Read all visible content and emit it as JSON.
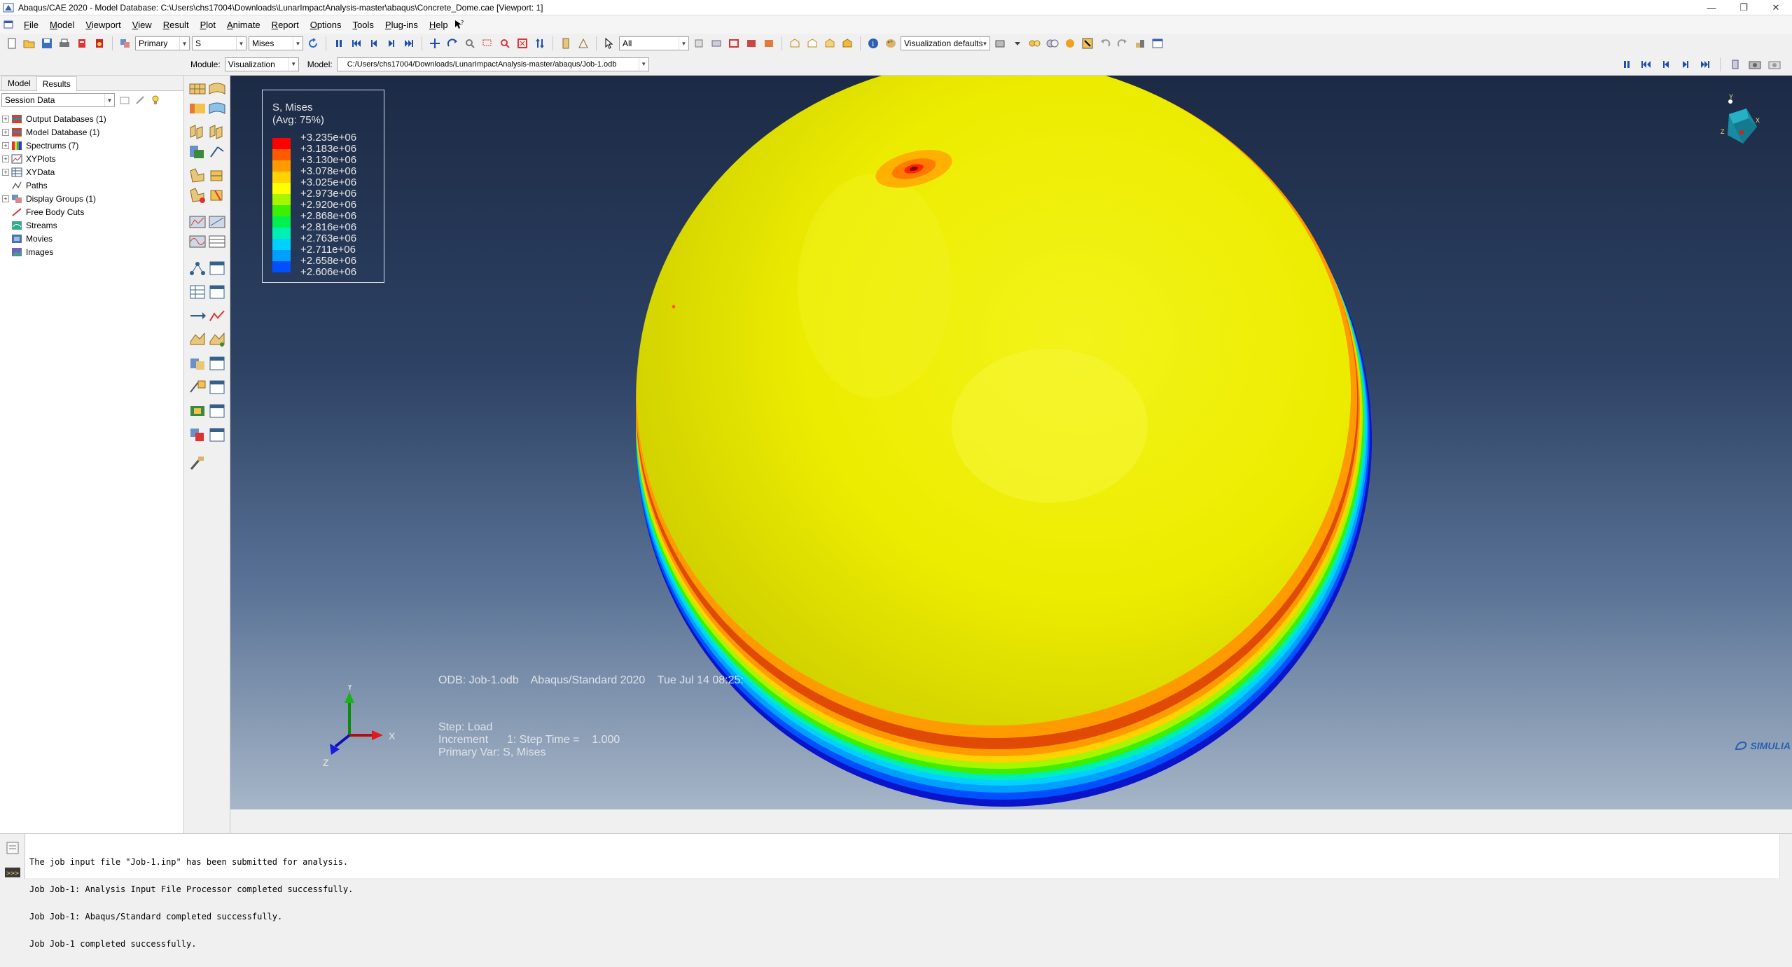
{
  "window": {
    "title": "Abaqus/CAE 2020 - Model Database: C:\\Users\\chs17004\\Downloads\\LunarImpactAnalysis-master\\abaqus\\Concrete_Dome.cae [Viewport: 1]",
    "min_glyph": "—",
    "max_glyph": "❐",
    "close_glyph": "✕"
  },
  "menu": [
    "File",
    "Model",
    "Viewport",
    "View",
    "Result",
    "Plot",
    "Animate",
    "Report",
    "Options",
    "Tools",
    "Plug-ins",
    "Help"
  ],
  "toolbar": {
    "display_group": "Primary",
    "variable": "S",
    "invariant": "Mises",
    "selection": "All",
    "view_defaults": "Visualization defaults",
    "module_label": "Module:",
    "module": "Visualization",
    "model_label": "Model:",
    "model_path": "C:/Users/chs17004/Downloads/LunarImpactAnalysis-master/abaqus/Job-1.odb"
  },
  "left_panel": {
    "tabs": [
      "Model",
      "Results"
    ],
    "active_tab": "Results",
    "session": "Session Data",
    "tree": [
      {
        "label": "Output Databases (1)",
        "expandable": true
      },
      {
        "label": "Model Database (1)",
        "expandable": true
      },
      {
        "label": "Spectrums (7)",
        "expandable": true
      },
      {
        "label": "XYPlots",
        "expandable": true
      },
      {
        "label": "XYData",
        "expandable": true
      },
      {
        "label": "Paths",
        "expandable": false
      },
      {
        "label": "Display Groups (1)",
        "expandable": true
      },
      {
        "label": "Free Body Cuts",
        "expandable": false
      },
      {
        "label": "Streams",
        "expandable": false
      },
      {
        "label": "Movies",
        "expandable": false
      },
      {
        "label": "Images",
        "expandable": false
      }
    ]
  },
  "legend": {
    "title": "S, Mises",
    "subtitle": "(Avg: 75%)",
    "values": [
      "+3.235e+06",
      "+3.183e+06",
      "+3.130e+06",
      "+3.078e+06",
      "+3.025e+06",
      "+2.973e+06",
      "+2.920e+06",
      "+2.868e+06",
      "+2.816e+06",
      "+2.763e+06",
      "+2.711e+06",
      "+2.658e+06",
      "+2.606e+06"
    ],
    "colors": [
      "#ff0000",
      "#ff5a00",
      "#ff9b00",
      "#ffd200",
      "#ffff00",
      "#a8f500",
      "#3cf000",
      "#00f050",
      "#00f0b4",
      "#00d2ff",
      "#00a0ff",
      "#0050ff",
      "#0000ff"
    ]
  },
  "viewport_info": {
    "odb_line": "ODB: Job-1.odb    Abaqus/Standard 2020    Tue Jul 14 08:25:",
    "step": "Step: Load",
    "increment": "Increment      1: Step Time =    1.000",
    "primary_var": "Primary Var: S, Mises"
  },
  "triad": {
    "y": "Y",
    "x": "X",
    "z": "Z"
  },
  "brand": "SIMULIA",
  "messages": [
    "The job input file \"Job-1.inp\" has been submitted for analysis.",
    "Job Job-1: Analysis Input File Processor completed successfully.",
    "Job Job-1: Abaqus/Standard completed successfully.",
    "Job Job-1 completed successfully."
  ]
}
